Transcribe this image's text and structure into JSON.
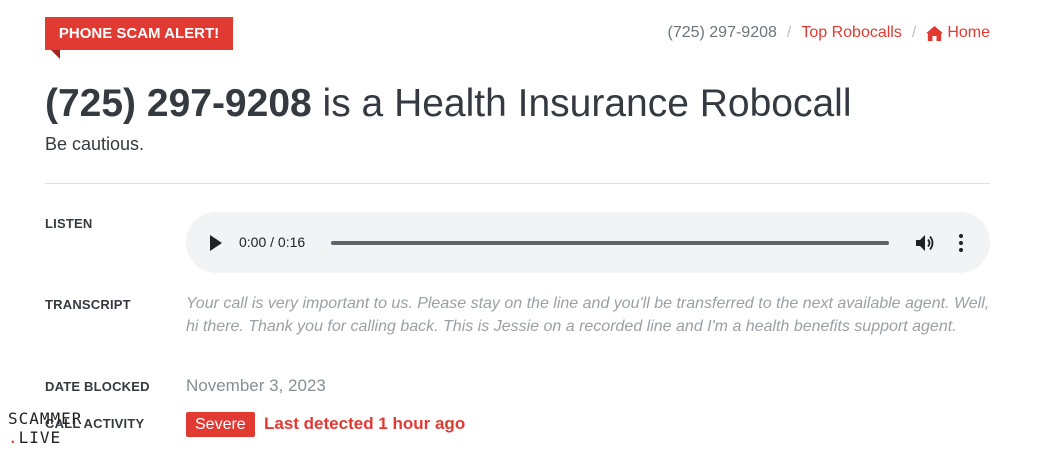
{
  "alert": {
    "label": "PHONE SCAM ALERT!"
  },
  "breadcrumb": {
    "current": "(725) 297-9208",
    "separator": "/",
    "top_robocalls": "Top Robocalls",
    "home": "Home"
  },
  "title": {
    "number": "(725) 297-9208",
    "rest": " is a Health Insurance Robocall",
    "subtitle": "Be cautious."
  },
  "rows": {
    "listen_label": "LISTEN",
    "transcript_label": "TRANSCRIPT",
    "date_label": "DATE BLOCKED",
    "activity_label": "CALL ACTIVITY"
  },
  "audio": {
    "time": "0:00 / 0:16",
    "progress": 0
  },
  "transcript": "Your call is very important to us. Please stay on the line and you'll be transferred to the next available agent. Well, hi there. Thank you for calling back. This is Jessie on a recorded line and I'm a health benefits support agent.",
  "date_blocked": "November 3, 2023",
  "activity": {
    "severity": "Severe",
    "last_detected": "Last detected 1 hour ago"
  },
  "watermark": {
    "line1": "SCAMMER",
    "line2_dot": ".",
    "line2": "LIVE"
  },
  "colors": {
    "accent": "#e03a33",
    "text": "#343a40",
    "muted": "#868e96"
  }
}
